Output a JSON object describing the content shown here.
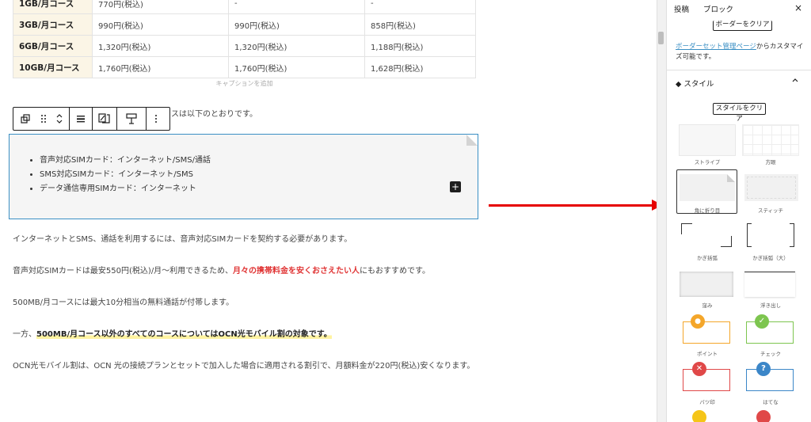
{
  "table": {
    "rows": [
      {
        "plan": "1GB/月コース",
        "c1": "770円(税込)",
        "c2": "-",
        "c3": "-"
      },
      {
        "plan": "3GB/月コース",
        "c1": "990円(税込)",
        "c2": "990円(税込)",
        "c3": "858円(税込)"
      },
      {
        "plan": "6GB/月コース",
        "c1": "1,320円(税込)",
        "c2": "1,320円(税込)",
        "c3": "1,188円(税込)"
      },
      {
        "plan": "10GB/月コース",
        "c1": "1,760円(税込)",
        "c2": "1,760円(税込)",
        "c3": "1,628円(税込)"
      }
    ],
    "caption_placeholder": "キャプションを追加"
  },
  "toolbar": {
    "after_text": "スは以下のとおりです。"
  },
  "block": {
    "items": [
      "音声対応SIMカード：インターネット/SMS/通話",
      "SMS対応SIMカード：インターネット/SMS",
      "データ通信専用SIMカード：インターネット"
    ],
    "inserter": "+"
  },
  "paragraphs": {
    "p1": "インターネットとSMS、通話を利用するには、音声対応SIMカードを契約する必要があります。",
    "p2_a": "音声対応SIMカードは最安550円(税込)/月～利用できるため、",
    "p2_b": "月々の携帯料金を安くおさえたい人",
    "p2_c": "にもおすすめです。",
    "p3": "500MB/月コースには最大10分相当の無料通話が付帯します。",
    "p4_a": "一方、",
    "p4_b": "500MB/月コース以外のすべてのコースについてはOCN光モバイル割の対象です。",
    "p5": "OCN光モバイル割は、OCN 光の接続プランとセットで加入した場合に適用される割引で、月額料金が220円(税込)安くなります。"
  },
  "sidebar": {
    "tab_post": "投稿",
    "tab_block": "ブロック",
    "close": "×",
    "clear_border": "ボーダーをクリア",
    "link_text": "ボーダーセット管理ページ",
    "link_suffix": "からカスタマイズ可能です。",
    "style_panel_title": "スタイル",
    "clear_style": "スタイルをクリア",
    "styles": [
      {
        "label": "ストライプ"
      },
      {
        "label": "方眼"
      },
      {
        "label": "角に折り目"
      },
      {
        "label": "スティッチ"
      },
      {
        "label": "かぎ括弧"
      },
      {
        "label": "かぎ括弧（大）"
      },
      {
        "label": "窪み"
      },
      {
        "label": "浮き出し"
      },
      {
        "label": "ポイント"
      },
      {
        "label": "チェック"
      },
      {
        "label": "バツ印"
      },
      {
        "label": "はてな"
      }
    ],
    "selected_style": "角に折り目"
  },
  "colors": {
    "accent": "#3a8fc4",
    "arrow": "#e60000",
    "point": "#f4a62a",
    "check": "#7dc54f",
    "cross": "#e04848",
    "question": "#3b86c8",
    "alert": "#f5c518",
    "note": "#e04848"
  }
}
